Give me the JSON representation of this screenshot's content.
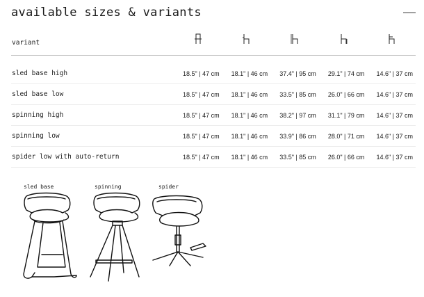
{
  "page": {
    "title": "available sizes & variants"
  },
  "table": {
    "variant_header": "variant",
    "dimension_icons": [
      "chair-width-icon",
      "chair-depth-icon",
      "chair-height-icon",
      "seat-height-icon",
      "armrest-height-icon"
    ],
    "rows": [
      {
        "variant": "sled base high",
        "values": [
          "18.5\" | 47 cm",
          "18.1\" | 46 cm",
          "37.4\" | 95 cm",
          "29.1\" | 74 cm",
          "14.6\" | 37 cm"
        ]
      },
      {
        "variant": "sled base low",
        "values": [
          "18.5\" | 47 cm",
          "18.1\" | 46 cm",
          "33.5\" | 85 cm",
          "26.0\" | 66 cm",
          "14.6\" | 37 cm"
        ]
      },
      {
        "variant": "spinning high",
        "values": [
          "18.5\" | 47 cm",
          "18.1\" | 46 cm",
          "38.2\" | 97 cm",
          "31.1\" | 79 cm",
          "14.6\" | 37 cm"
        ]
      },
      {
        "variant": "spinning low",
        "values": [
          "18.5\" | 47 cm",
          "18.1\" | 46 cm",
          "33.9\" | 86 cm",
          "28.0\" | 71 cm",
          "14.6\" | 37 cm"
        ]
      },
      {
        "variant": "spider low with auto-return",
        "values": [
          "18.5\" | 47 cm",
          "18.1\" | 46 cm",
          "33.5\" | 85 cm",
          "26.0\" | 66 cm",
          "14.6\" | 37 cm"
        ]
      }
    ]
  },
  "bases": [
    {
      "label": "sled base"
    },
    {
      "label": "spinning"
    },
    {
      "label": "spider"
    }
  ]
}
